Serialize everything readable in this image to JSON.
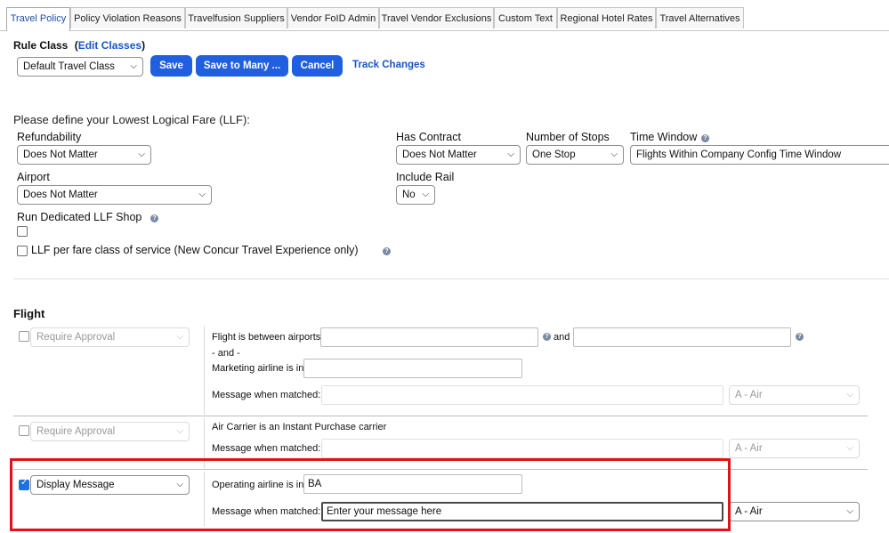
{
  "tabs": [
    {
      "label": "Travel Policy",
      "active": true
    },
    {
      "label": "Policy Violation Reasons",
      "active": false
    },
    {
      "label": "Travelfusion Suppliers",
      "active": false
    },
    {
      "label": "Vendor FoID Admin",
      "active": false
    },
    {
      "label": "Travel Vendor Exclusions",
      "active": false
    },
    {
      "label": "Custom Text",
      "active": false
    },
    {
      "label": "Regional Hotel Rates",
      "active": false
    },
    {
      "label": "Travel Alternatives",
      "active": false
    }
  ],
  "rule_class": {
    "label": "Rule Class",
    "paren_open": "(",
    "edit_link": "Edit Classes",
    "paren_close": ")",
    "selected": "Default Travel Class",
    "save": "Save",
    "save_many": "Save to Many ...",
    "cancel": "Cancel",
    "track_changes": "Track Changes"
  },
  "llf": {
    "heading": "Please define your Lowest Logical Fare (LLF):",
    "refundability_label": "Refundability",
    "refundability_value": "Does Not Matter",
    "has_contract_label": "Has Contract",
    "has_contract_value": "Does Not Matter",
    "stops_label": "Number of Stops",
    "stops_value": "One Stop",
    "time_window_label": "Time Window",
    "time_window_value": "Flights Within Company Config Time Window",
    "airport_label": "Airport",
    "airport_value": "Does Not Matter",
    "include_rail_label": "Include Rail",
    "include_rail_value": "No",
    "dedicated_label": "Run Dedicated LLF Shop",
    "per_fare_label": "LLF per fare class of service (New Concur Travel Experience only)"
  },
  "flight": {
    "heading": "Flight",
    "rules": [
      {
        "action": "Require Approval",
        "checked": false,
        "between_label": "Flight is between airports",
        "and_label": "and",
        "and_sep": "- and -",
        "marketing_label": "Marketing airline is in",
        "message_label": "Message when matched:",
        "message_value": "",
        "category": "A - Air"
      },
      {
        "action": "Require Approval",
        "checked": false,
        "carrier_label": "Air Carrier is an Instant Purchase carrier",
        "message_label": "Message when matched:",
        "message_value": "",
        "category": "A - Air"
      },
      {
        "action": "Display Message",
        "checked": true,
        "operating_label": "Operating airline is in",
        "operating_value": "BA",
        "message_label": "Message when matched:",
        "message_value": "Enter your message here",
        "category": "A - Air"
      }
    ]
  },
  "icons": {
    "help": "help-circle-icon",
    "chevron": "chevron-down-icon",
    "check": "checkmark-icon"
  },
  "colors": {
    "primary_button": "#1f5fe0",
    "link": "#1a56c8",
    "highlight_box": "#e0131b",
    "checkbox_checked": "#1f6fe5"
  }
}
